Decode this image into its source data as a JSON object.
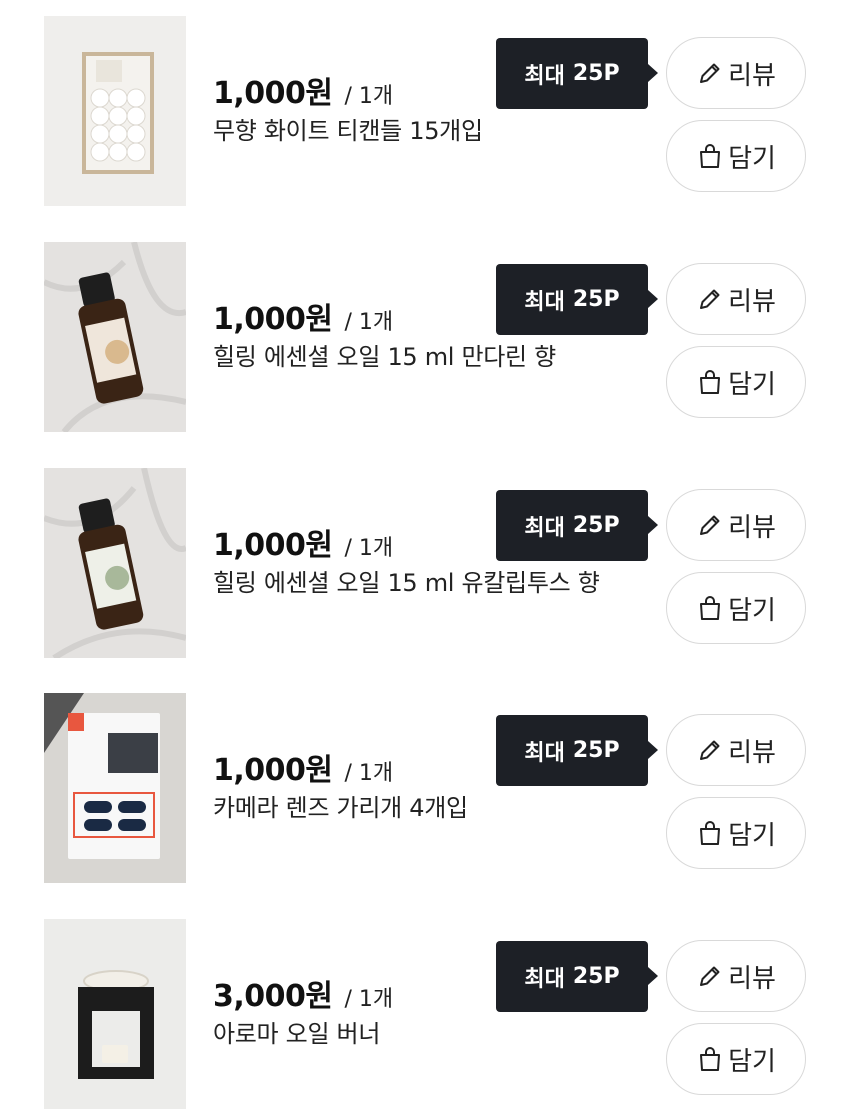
{
  "labels": {
    "points": "최대",
    "points_value": "25P",
    "review": "리뷰",
    "cart": "담기"
  },
  "products": [
    {
      "price": "1,000원",
      "qty": "/ 1개",
      "name": "무향 화이트 티캔들 15개입",
      "image_icon": "tealight-candles-icon"
    },
    {
      "price": "1,000원",
      "qty": "/ 1개",
      "name": "힐링 에센셜 오일 15 ml 만다린 향",
      "image_icon": "essential-oil-bottle-icon"
    },
    {
      "price": "1,000원",
      "qty": "/ 1개",
      "name": "힐링 에센셜 오일 15 ml 유칼립투스 향",
      "image_icon": "essential-oil-bottle-icon"
    },
    {
      "price": "1,000원",
      "qty": "/ 1개",
      "name": "카메라 렌즈 가리개 4개입",
      "image_icon": "camera-lens-cover-icon"
    },
    {
      "price": "3,000원",
      "qty": "/ 1개",
      "name": "아로마 오일 버너",
      "image_icon": "oil-burner-icon"
    }
  ],
  "colors": {
    "tooltip_bg": "#1d2026",
    "button_border": "#d9d9d9"
  }
}
